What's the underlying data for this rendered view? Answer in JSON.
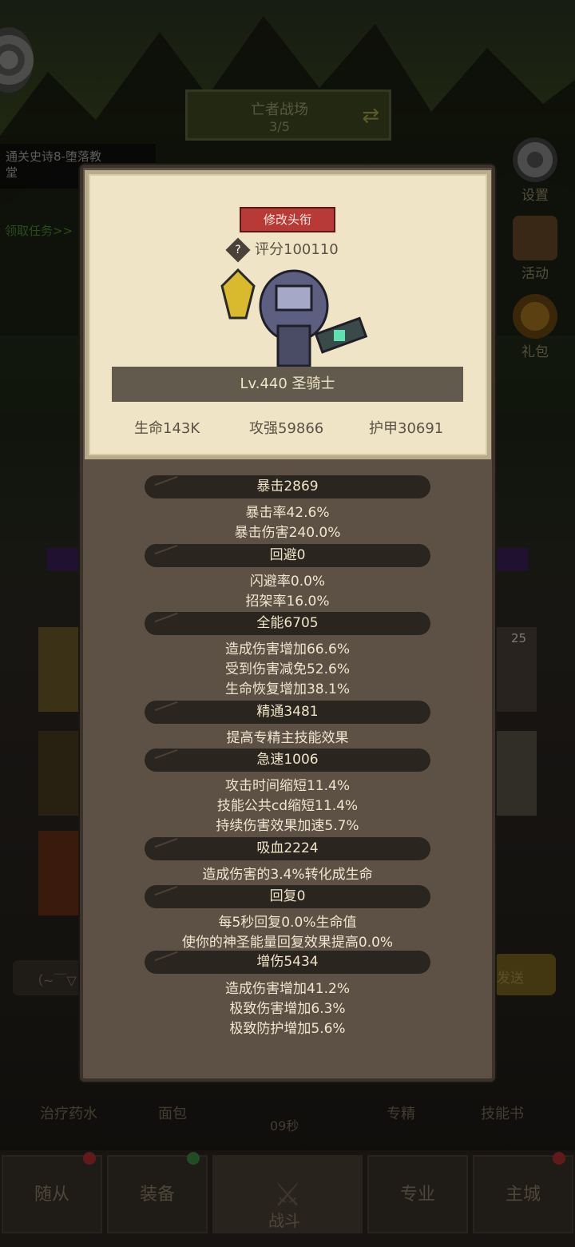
{
  "stage": {
    "name": "亡者战场",
    "progress": "3/5"
  },
  "quest": {
    "text": "通关史诗8-堕落教堂",
    "link": "领取任务>>"
  },
  "side_menu": [
    {
      "label": "设置",
      "icon": "gear-icon"
    },
    {
      "label": "活动",
      "icon": "scroll-icon"
    },
    {
      "label": "礼包",
      "icon": "gift-icon"
    }
  ],
  "chat_snippet": "（~￣▽",
  "send_label": "发送",
  "consumables": {
    "potion": "治疗药水",
    "bread": "面包",
    "timer": "09秒",
    "specialty": "专精",
    "skillbook": "技能书"
  },
  "badge_count": "25",
  "nav": [
    {
      "label": "随从",
      "badge": "red"
    },
    {
      "label": "装备",
      "badge": "green"
    },
    {
      "label": "战斗",
      "badge": ""
    },
    {
      "label": "专业",
      "badge": ""
    },
    {
      "label": "主城",
      "badge": "red"
    }
  ],
  "hero": {
    "title_button": "修改头衔",
    "score": "评分100110",
    "level_class": "Lv.440 圣骑士",
    "hp": "生命143K",
    "attack": "攻强59866",
    "armor": "护甲30691"
  },
  "stats": [
    {
      "header": "暴击2869",
      "lines": [
        "暴击率42.6%",
        "暴击伤害240.0%"
      ]
    },
    {
      "header": "回避0",
      "lines": [
        "闪避率0.0%",
        "招架率16.0%"
      ]
    },
    {
      "header": "全能6705",
      "lines": [
        "造成伤害增加66.6%",
        "受到伤害减免52.6%",
        "生命恢复增加38.1%"
      ]
    },
    {
      "header": "精通3481",
      "lines": [
        "提高专精主技能效果"
      ]
    },
    {
      "header": "急速1006",
      "lines": [
        "攻击时间缩短11.4%",
        "技能公共cd缩短11.4%",
        "持续伤害效果加速5.7%"
      ]
    },
    {
      "header": "吸血2224",
      "lines": [
        "造成伤害的3.4%转化成生命"
      ]
    },
    {
      "header": "回复0",
      "lines": [
        "每5秒回复0.0%生命值",
        "使你的神圣能量回复效果提高0.0%"
      ]
    },
    {
      "header": "增伤5434",
      "lines": [
        "造成伤害增加41.2%",
        "极致伤害增加6.3%",
        "极致防护增加5.6%"
      ]
    }
  ],
  "colors": {
    "popup_bg": "#5c5144",
    "card_bg": "#efe4c6",
    "title_btn": "#b73a37",
    "pill_bg": "#2b2520"
  }
}
